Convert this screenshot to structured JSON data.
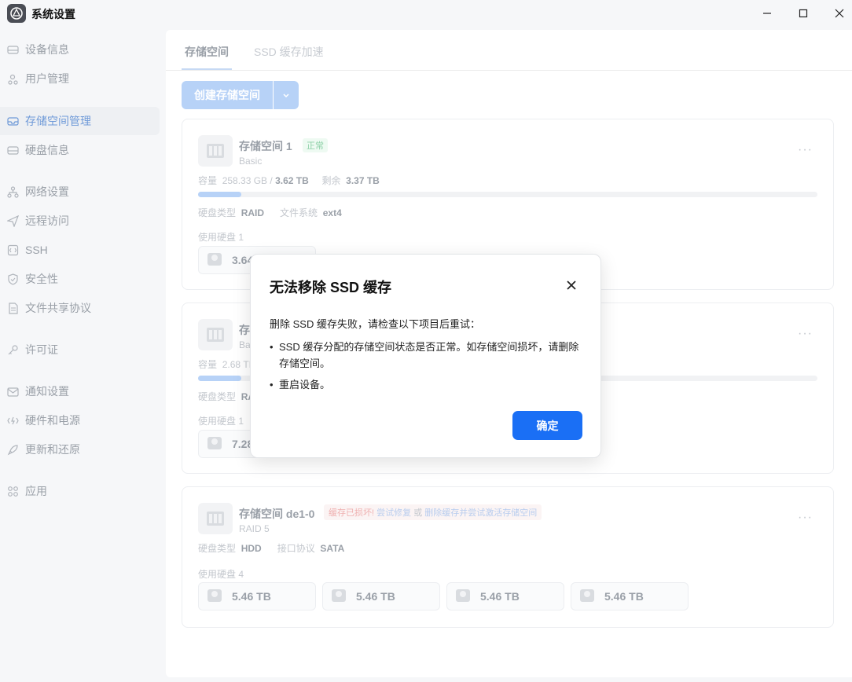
{
  "window": {
    "title": "系统设置",
    "controls": [
      "minimize-icon",
      "maximize-icon",
      "close-icon"
    ]
  },
  "sidebar": {
    "items": [
      {
        "label": "设备信息",
        "icon": "monitor-icon"
      },
      {
        "label": "用户管理",
        "icon": "users-icon"
      },
      {
        "label": "存储空间管理",
        "icon": "storage-icon",
        "active": true
      },
      {
        "label": "硬盘信息",
        "icon": "drive-icon"
      },
      {
        "label": "网络设置",
        "icon": "network-icon"
      },
      {
        "label": "远程访问",
        "icon": "send-icon"
      },
      {
        "label": "SSH",
        "icon": "terminal-icon"
      },
      {
        "label": "安全性",
        "icon": "shield-icon"
      },
      {
        "label": "文件共享协议",
        "icon": "document-icon"
      },
      {
        "label": "许可证",
        "icon": "key-icon"
      },
      {
        "label": "通知设置",
        "icon": "mail-icon"
      },
      {
        "label": "硬件和电源",
        "icon": "power-icon"
      },
      {
        "label": "更新和还原",
        "icon": "rocket-icon"
      },
      {
        "label": "应用",
        "icon": "apps-icon"
      }
    ]
  },
  "main": {
    "tabs": [
      {
        "label": "存储空间",
        "active": true
      },
      {
        "label": "SSD 缓存加速",
        "active": false
      }
    ],
    "create_button": "创建存储空间",
    "pools": [
      {
        "name": "存储空间 1",
        "status": "正常",
        "type": "Basic",
        "capacity_label": "容量",
        "capacity_used": "258.33 GB",
        "capacity_sep": "/",
        "capacity_total": "3.62 TB",
        "remaining_label": "剩余",
        "remaining": "3.37 TB",
        "usage_fraction": 0.07,
        "disk_type_label": "硬盘类型",
        "disk_type": "RAID",
        "fs_label": "文件系统",
        "fs": "ext4",
        "disks_label": "使用硬盘 1",
        "disks": [
          "3.64 TB"
        ]
      },
      {
        "name": "存储空间 2",
        "type": "Basic",
        "capacity_label": "容量",
        "capacity_text": "2.68 TB",
        "usage_fraction": 0.07,
        "disk_type_label": "硬盘类型",
        "disk_type": "RAID",
        "disks_label": "使用硬盘 1",
        "disks": [
          "7.28 TB"
        ]
      },
      {
        "name": "存储空间 de1-0",
        "warn": "缓存已损坏!",
        "repair_link": "尝试修复",
        "or": "或",
        "delete_link": "删除缓存并尝试激活存储空间",
        "type": "RAID 5",
        "disk_type_label": "硬盘类型",
        "disk_type": "HDD",
        "iface_label": "接口协议",
        "iface": "SATA",
        "disks_label": "使用硬盘 4",
        "disks": [
          "5.46 TB",
          "5.46 TB",
          "5.46 TB",
          "5.46 TB"
        ]
      }
    ]
  },
  "dialog": {
    "title": "无法移除 SSD 缓存",
    "message": "删除 SSD 缓存失败，请检查以下项目后重试：",
    "bullets": [
      "SSD 缓存分配的存储空间状态是否正常。如存储空间损坏，请删除存储空间。",
      "重启设备。"
    ],
    "ok": "确定"
  },
  "colors": {
    "accent": "#1a6ff5",
    "sidebar_active": "#6f9ad8",
    "status_ok": "#8fd1a8",
    "status_warn": "#efb0b0"
  }
}
